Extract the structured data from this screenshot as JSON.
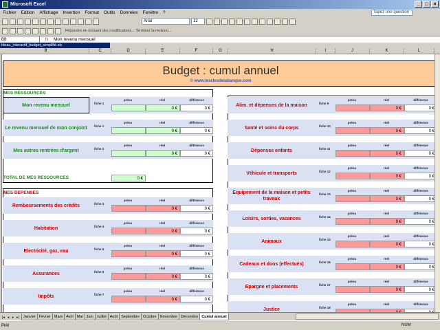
{
  "window": {
    "title": "Microsoft Excel"
  },
  "menu": [
    "Fichier",
    "Edition",
    "Affichage",
    "Insertion",
    "Format",
    "Outils",
    "Données",
    "Fenêtre",
    "?"
  ],
  "help_placeholder": "Tapez une question",
  "toolbar": {
    "font": "Arial",
    "size": "12",
    "review_text": "Répondre en incluant des modifications...   Terminer la révision..."
  },
  "formula": {
    "cell": "B8",
    "fx": "fx",
    "value": "Mon revenu mensuel"
  },
  "file_title": "bleau_interactif_budget_simplifié.xls",
  "columns": [
    "B",
    "C",
    "D",
    "E",
    "F",
    "G",
    "H",
    "I",
    "J",
    "K",
    "L"
  ],
  "banner": {
    "title": "Budget : cumul annuel",
    "url": "© www.lesclesdelabanque.com"
  },
  "sub_headers": {
    "prevu": "prévu",
    "reel": "réel",
    "diff": "différence"
  },
  "resources": {
    "header": "MES RESSOURCES",
    "total": "TOTAL DE MES RESSOURCES",
    "total_value": "0 €",
    "rows": [
      {
        "label": "Mon revenu mensuel",
        "fiche": "fiche 1",
        "prevu": "",
        "reel": "0 €",
        "diff": "0 €"
      },
      {
        "label": "Le revenu mensuel de mon conjoint",
        "fiche": "fiche 1",
        "prevu": "",
        "reel": "0 €",
        "diff": "0 €"
      },
      {
        "label": "Mes autres rentrées d'argent",
        "fiche": "fiche 2",
        "prevu": "",
        "reel": "0 €",
        "diff": "0 €"
      }
    ]
  },
  "expenses": {
    "header": "MES DEPENSES",
    "rows": [
      {
        "label": "Remboursements des crédits",
        "fiche": "fiche 3",
        "reel": "0 €",
        "diff": "0 €"
      },
      {
        "label": "Habitation",
        "fiche": "fiche 4",
        "reel": "0 €",
        "diff": "0 €"
      },
      {
        "label": "Electricité, gaz, eau",
        "fiche": "fiche 5",
        "reel": "0 €",
        "diff": "0 €"
      },
      {
        "label": "Assurances",
        "fiche": "fiche 6",
        "reel": "0 €",
        "diff": "0 €"
      },
      {
        "label": "Impôts",
        "fiche": "fiche 7",
        "reel": "0 €",
        "diff": "0 €"
      }
    ]
  },
  "right": {
    "rows": [
      {
        "label": "Alim. et dépenses de la maison",
        "fiche": "fiche 9",
        "reel": "0 €",
        "diff": "0 €"
      },
      {
        "label": "Santé et soins du corps",
        "fiche": "fiche 10",
        "reel": "0 €",
        "diff": "0 €"
      },
      {
        "label": "Dépenses enfants",
        "fiche": "fiche 11",
        "reel": "0 €",
        "diff": "0 €"
      },
      {
        "label": "Véhicule et transports",
        "fiche": "fiche 12",
        "reel": "0 €",
        "diff": "0 €"
      },
      {
        "label": "Equipement de la maison et petits travaux",
        "fiche": "fiche 13",
        "reel": "0 €",
        "diff": "0 €"
      },
      {
        "label": "Loisirs, sorties, vacances",
        "fiche": "fiche 14",
        "reel": "0 €",
        "diff": "0 €"
      },
      {
        "label": "Animaux",
        "fiche": "fiche 15",
        "reel": "0 €",
        "diff": "0 €"
      },
      {
        "label": "Cadeaux et dons (effectués)",
        "fiche": "fiche 16",
        "reel": "0 €",
        "diff": "0 €"
      },
      {
        "label": "Epargne et placements",
        "fiche": "fiche 17",
        "reel": "0 €",
        "diff": "0 €"
      },
      {
        "label": "Justice",
        "fiche": "fiche 18",
        "reel": "0 €",
        "diff": "0 €"
      }
    ]
  },
  "tabs": [
    "Janvier",
    "Février",
    "Mars",
    "Avril",
    "Mai",
    "Juin",
    "Juillet",
    "Août",
    "Septembre",
    "Octobre",
    "Novembre",
    "Décembre",
    "Cumul annuel"
  ],
  "active_tab": "Cumul annuel",
  "status": {
    "left": "Prêt",
    "num": "NUM"
  },
  "colors": {
    "green_cell": "#ccffcc",
    "red_cell": "#ff9999",
    "banner": "#ffcc99",
    "band": "#d9e1f2"
  }
}
